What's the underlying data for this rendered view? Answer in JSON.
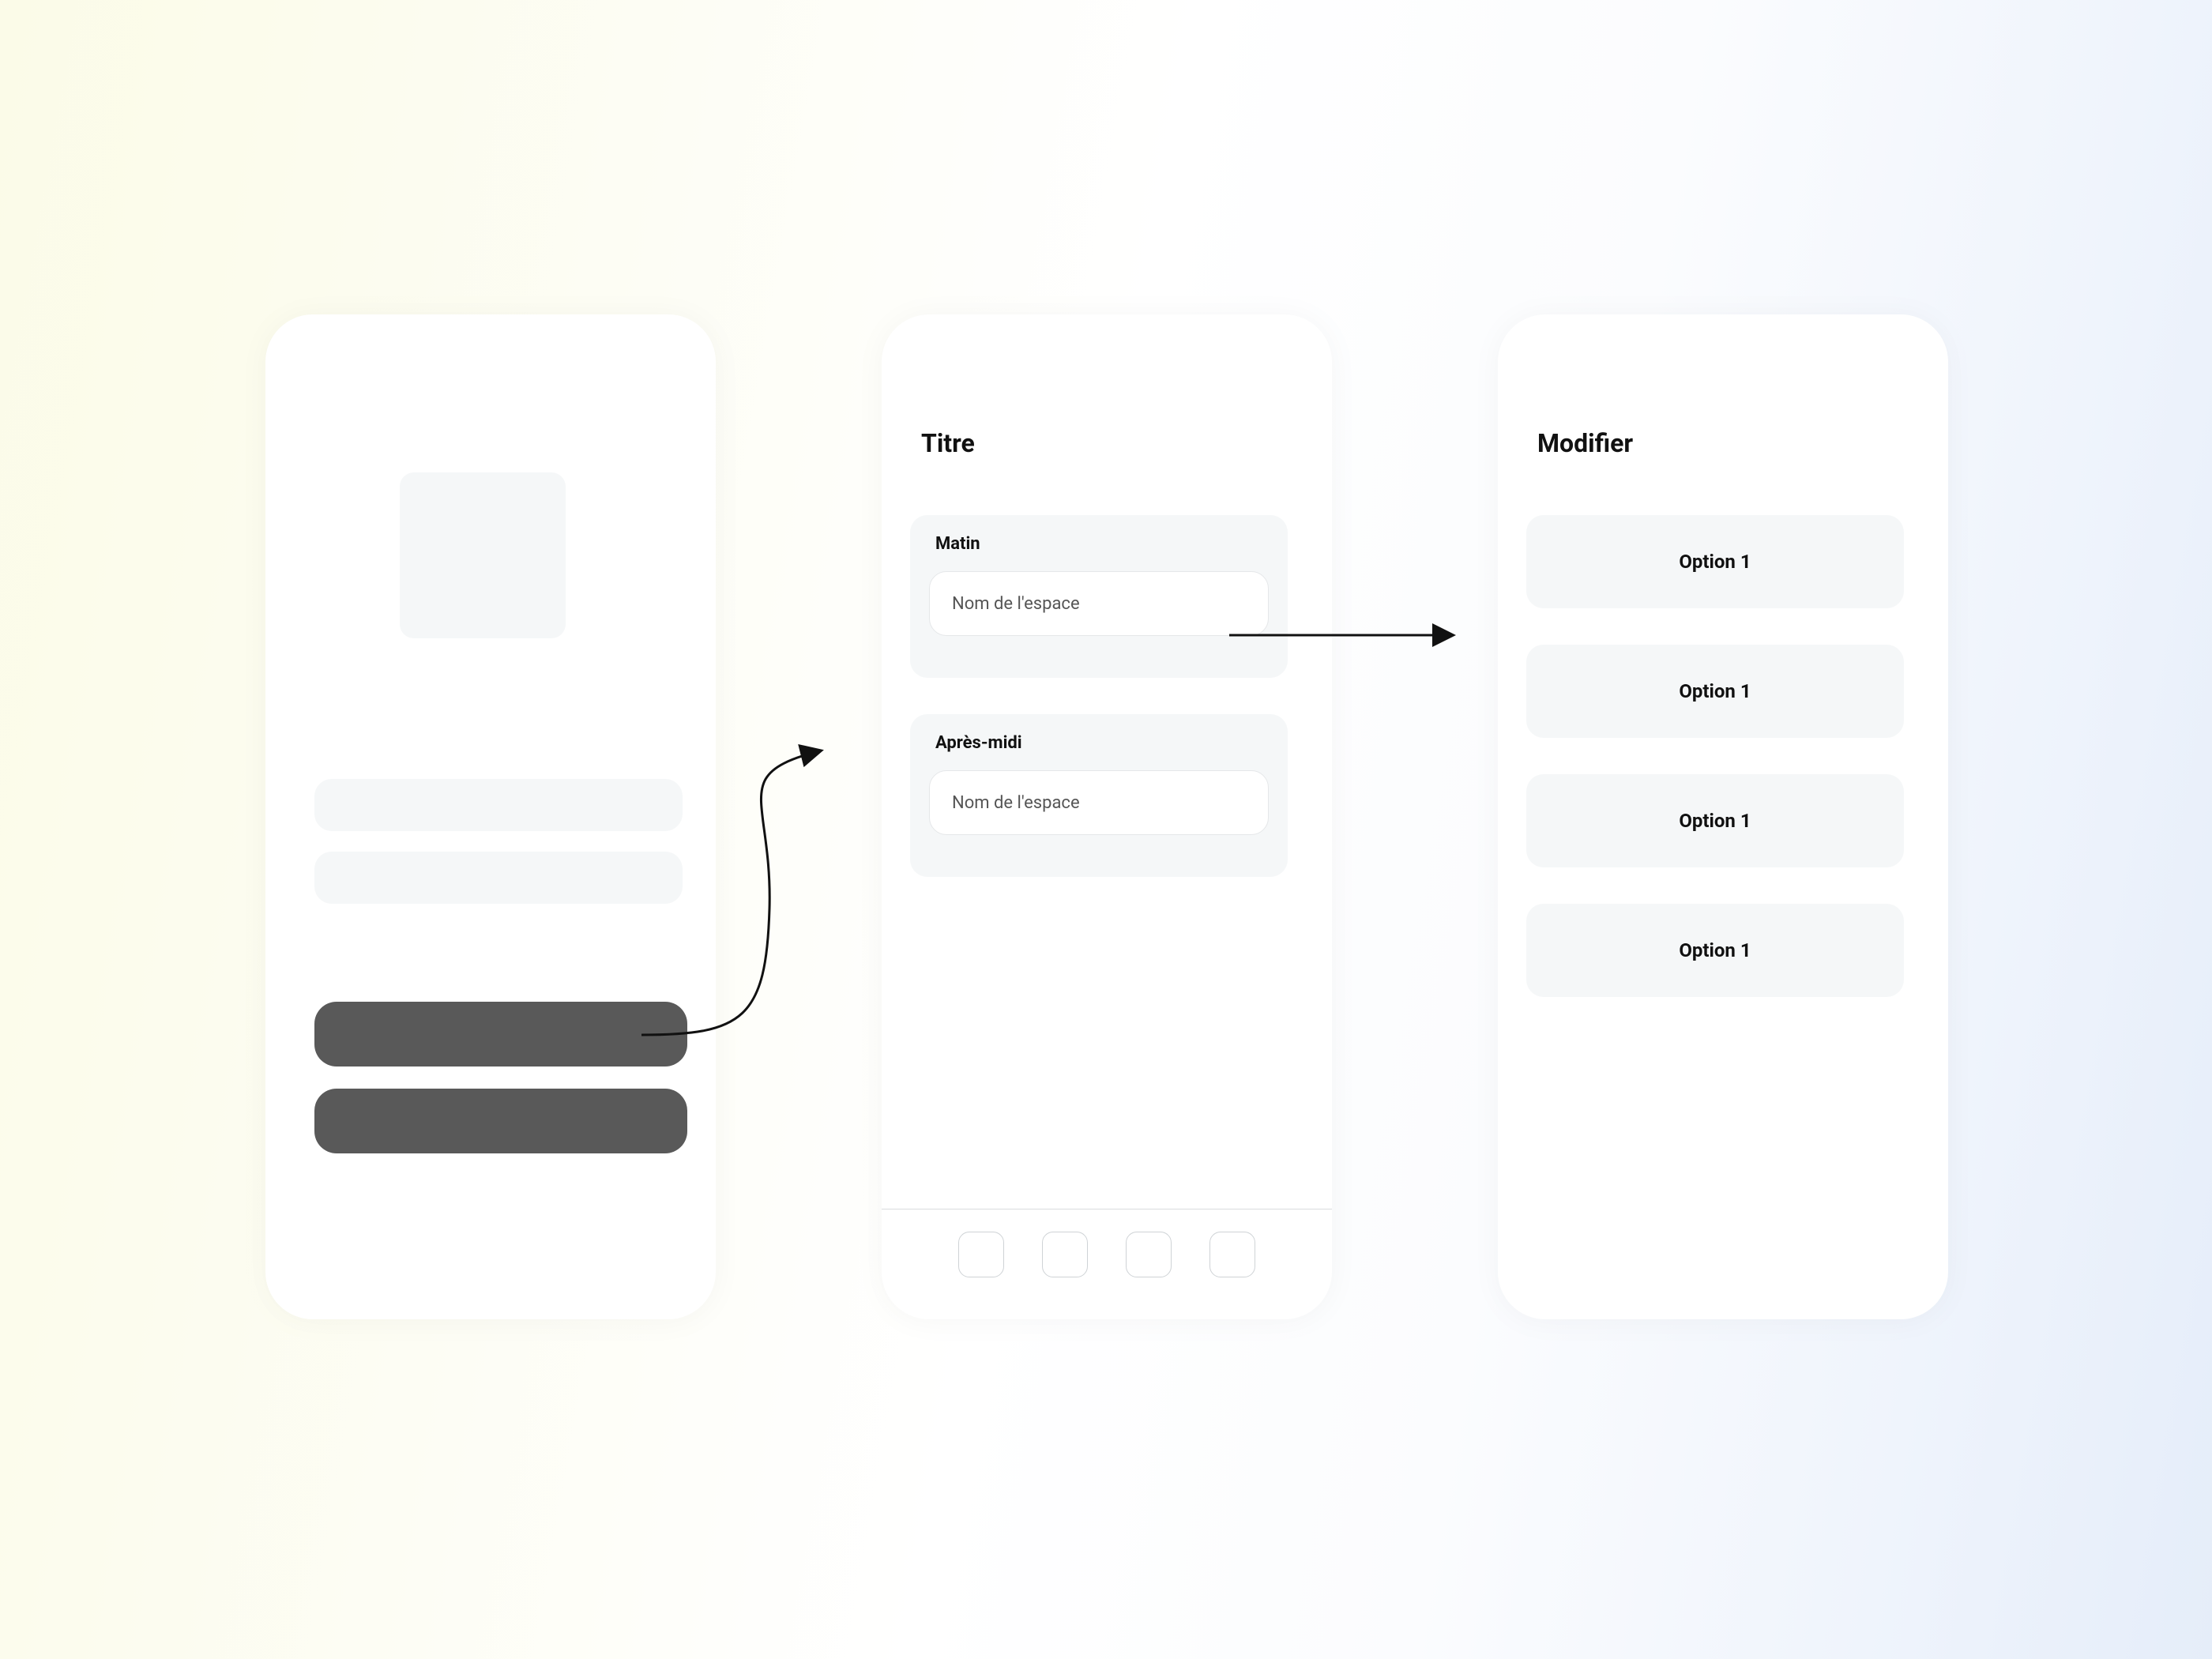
{
  "screens": {
    "screen2": {
      "title": "Titre",
      "sections": {
        "matin": {
          "label": "Matin",
          "placeholder": "Nom de l'espace"
        },
        "apresmidi": {
          "label": "Après-midi",
          "placeholder": "Nom de l'espace"
        }
      }
    },
    "screen3": {
      "title": "Modifier",
      "options": {
        "option1": "Option 1",
        "option2": "Option 1",
        "option3": "Option 1",
        "option4": "Option 1"
      }
    }
  }
}
